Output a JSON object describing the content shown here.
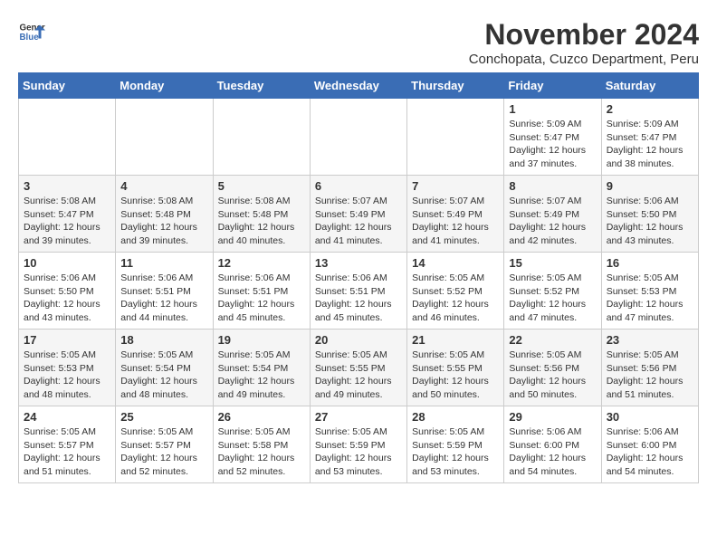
{
  "header": {
    "logo_general": "General",
    "logo_blue": "Blue",
    "title": "November 2024",
    "subtitle": "Conchopata, Cuzco Department, Peru"
  },
  "weekdays": [
    "Sunday",
    "Monday",
    "Tuesday",
    "Wednesday",
    "Thursday",
    "Friday",
    "Saturday"
  ],
  "weeks": [
    {
      "days": [
        {
          "num": "",
          "info": ""
        },
        {
          "num": "",
          "info": ""
        },
        {
          "num": "",
          "info": ""
        },
        {
          "num": "",
          "info": ""
        },
        {
          "num": "",
          "info": ""
        },
        {
          "num": "1",
          "info": "Sunrise: 5:09 AM\nSunset: 5:47 PM\nDaylight: 12 hours\nand 37 minutes."
        },
        {
          "num": "2",
          "info": "Sunrise: 5:09 AM\nSunset: 5:47 PM\nDaylight: 12 hours\nand 38 minutes."
        }
      ]
    },
    {
      "days": [
        {
          "num": "3",
          "info": "Sunrise: 5:08 AM\nSunset: 5:47 PM\nDaylight: 12 hours\nand 39 minutes."
        },
        {
          "num": "4",
          "info": "Sunrise: 5:08 AM\nSunset: 5:48 PM\nDaylight: 12 hours\nand 39 minutes."
        },
        {
          "num": "5",
          "info": "Sunrise: 5:08 AM\nSunset: 5:48 PM\nDaylight: 12 hours\nand 40 minutes."
        },
        {
          "num": "6",
          "info": "Sunrise: 5:07 AM\nSunset: 5:49 PM\nDaylight: 12 hours\nand 41 minutes."
        },
        {
          "num": "7",
          "info": "Sunrise: 5:07 AM\nSunset: 5:49 PM\nDaylight: 12 hours\nand 41 minutes."
        },
        {
          "num": "8",
          "info": "Sunrise: 5:07 AM\nSunset: 5:49 PM\nDaylight: 12 hours\nand 42 minutes."
        },
        {
          "num": "9",
          "info": "Sunrise: 5:06 AM\nSunset: 5:50 PM\nDaylight: 12 hours\nand 43 minutes."
        }
      ]
    },
    {
      "days": [
        {
          "num": "10",
          "info": "Sunrise: 5:06 AM\nSunset: 5:50 PM\nDaylight: 12 hours\nand 43 minutes."
        },
        {
          "num": "11",
          "info": "Sunrise: 5:06 AM\nSunset: 5:51 PM\nDaylight: 12 hours\nand 44 minutes."
        },
        {
          "num": "12",
          "info": "Sunrise: 5:06 AM\nSunset: 5:51 PM\nDaylight: 12 hours\nand 45 minutes."
        },
        {
          "num": "13",
          "info": "Sunrise: 5:06 AM\nSunset: 5:51 PM\nDaylight: 12 hours\nand 45 minutes."
        },
        {
          "num": "14",
          "info": "Sunrise: 5:05 AM\nSunset: 5:52 PM\nDaylight: 12 hours\nand 46 minutes."
        },
        {
          "num": "15",
          "info": "Sunrise: 5:05 AM\nSunset: 5:52 PM\nDaylight: 12 hours\nand 47 minutes."
        },
        {
          "num": "16",
          "info": "Sunrise: 5:05 AM\nSunset: 5:53 PM\nDaylight: 12 hours\nand 47 minutes."
        }
      ]
    },
    {
      "days": [
        {
          "num": "17",
          "info": "Sunrise: 5:05 AM\nSunset: 5:53 PM\nDaylight: 12 hours\nand 48 minutes."
        },
        {
          "num": "18",
          "info": "Sunrise: 5:05 AM\nSunset: 5:54 PM\nDaylight: 12 hours\nand 48 minutes."
        },
        {
          "num": "19",
          "info": "Sunrise: 5:05 AM\nSunset: 5:54 PM\nDaylight: 12 hours\nand 49 minutes."
        },
        {
          "num": "20",
          "info": "Sunrise: 5:05 AM\nSunset: 5:55 PM\nDaylight: 12 hours\nand 49 minutes."
        },
        {
          "num": "21",
          "info": "Sunrise: 5:05 AM\nSunset: 5:55 PM\nDaylight: 12 hours\nand 50 minutes."
        },
        {
          "num": "22",
          "info": "Sunrise: 5:05 AM\nSunset: 5:56 PM\nDaylight: 12 hours\nand 50 minutes."
        },
        {
          "num": "23",
          "info": "Sunrise: 5:05 AM\nSunset: 5:56 PM\nDaylight: 12 hours\nand 51 minutes."
        }
      ]
    },
    {
      "days": [
        {
          "num": "24",
          "info": "Sunrise: 5:05 AM\nSunset: 5:57 PM\nDaylight: 12 hours\nand 51 minutes."
        },
        {
          "num": "25",
          "info": "Sunrise: 5:05 AM\nSunset: 5:57 PM\nDaylight: 12 hours\nand 52 minutes."
        },
        {
          "num": "26",
          "info": "Sunrise: 5:05 AM\nSunset: 5:58 PM\nDaylight: 12 hours\nand 52 minutes."
        },
        {
          "num": "27",
          "info": "Sunrise: 5:05 AM\nSunset: 5:59 PM\nDaylight: 12 hours\nand 53 minutes."
        },
        {
          "num": "28",
          "info": "Sunrise: 5:05 AM\nSunset: 5:59 PM\nDaylight: 12 hours\nand 53 minutes."
        },
        {
          "num": "29",
          "info": "Sunrise: 5:06 AM\nSunset: 6:00 PM\nDaylight: 12 hours\nand 54 minutes."
        },
        {
          "num": "30",
          "info": "Sunrise: 5:06 AM\nSunset: 6:00 PM\nDaylight: 12 hours\nand 54 minutes."
        }
      ]
    }
  ]
}
